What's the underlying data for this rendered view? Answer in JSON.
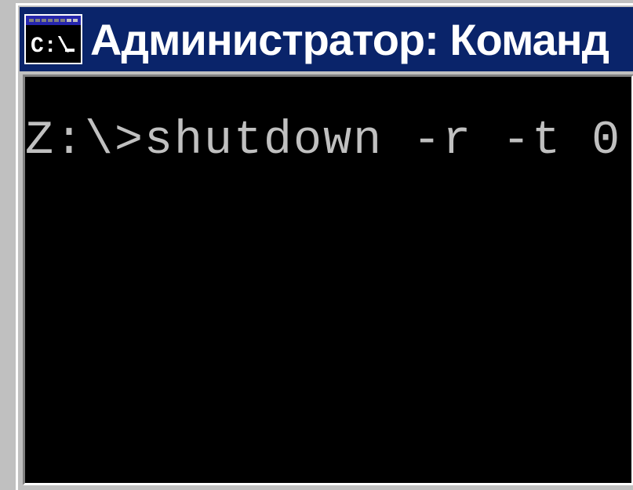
{
  "window": {
    "title": "Администратор: Команд"
  },
  "console": {
    "prompt": "Z:\\>",
    "command": "shutdown -r -t 0"
  }
}
